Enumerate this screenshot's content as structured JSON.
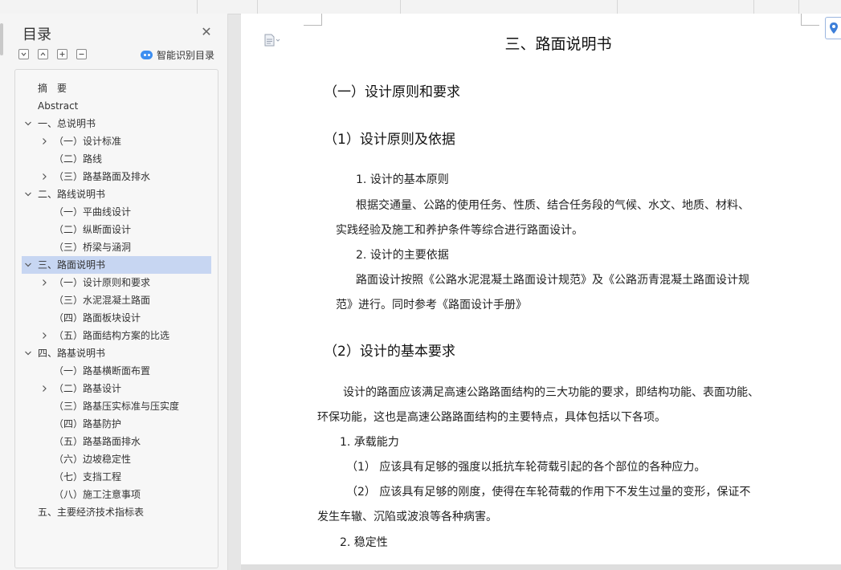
{
  "toc": {
    "title": "目录",
    "ai_button_label": "智能识别目录",
    "items": [
      {
        "label": "摘　要",
        "level": 0,
        "expand": "none"
      },
      {
        "label": "Abstract",
        "level": 0,
        "expand": "none"
      },
      {
        "label": "一、总说明书",
        "level": 0,
        "expand": "expanded"
      },
      {
        "label": "（一）设计标准",
        "level": 1,
        "expand": "collapsed"
      },
      {
        "label": "（二）路线",
        "level": 1,
        "expand": "none"
      },
      {
        "label": "（三）路基路面及排水",
        "level": 1,
        "expand": "collapsed"
      },
      {
        "label": "二、路线说明书",
        "level": 0,
        "expand": "expanded"
      },
      {
        "label": "（一）平曲线设计",
        "level": 1,
        "expand": "none"
      },
      {
        "label": "（二）纵断面设计",
        "level": 1,
        "expand": "none"
      },
      {
        "label": "（三）桥梁与涵洞",
        "level": 1,
        "expand": "none"
      },
      {
        "label": "三、路面说明书",
        "level": 0,
        "expand": "expanded",
        "selected": true
      },
      {
        "label": "（一）设计原则和要求",
        "level": 1,
        "expand": "collapsed"
      },
      {
        "label": "（三）水泥混凝土路面",
        "level": 1,
        "expand": "none"
      },
      {
        "label": "（四）路面板块设计",
        "level": 1,
        "expand": "none"
      },
      {
        "label": "（五）路面结构方案的比选",
        "level": 1,
        "expand": "collapsed"
      },
      {
        "label": "四、路基说明书",
        "level": 0,
        "expand": "expanded"
      },
      {
        "label": "（一）路基横断面布置",
        "level": 1,
        "expand": "none"
      },
      {
        "label": "（二）路基设计",
        "level": 1,
        "expand": "collapsed"
      },
      {
        "label": "（三）路基压实标准与压实度",
        "level": 1,
        "expand": "none"
      },
      {
        "label": "（四）路基防护",
        "level": 1,
        "expand": "none"
      },
      {
        "label": "（五）路基路面排水",
        "level": 1,
        "expand": "none"
      },
      {
        "label": "（六）边坡稳定性",
        "level": 1,
        "expand": "none"
      },
      {
        "label": "（七）支挡工程",
        "level": 1,
        "expand": "none"
      },
      {
        "label": "（八）施工注意事项",
        "level": 1,
        "expand": "none"
      },
      {
        "label": "五、主要经济技术指标表",
        "level": 0,
        "expand": "none"
      }
    ]
  },
  "document": {
    "lines": [
      {
        "text": "三、路面说明书",
        "style": "h0"
      },
      {
        "text": "（一）设计原则和要求",
        "style": "h1"
      },
      {
        "text": "（1）设计原则及依据",
        "style": "h1"
      },
      {
        "text": "1. 设计的基本原则",
        "style": "p"
      },
      {
        "text": "根据交通量、公路的使用任务、性质、结合任务段的气候、水文、地质、材料、",
        "style": "p"
      },
      {
        "text": "实践经验及施工和养护条件等综合进行路面设计。",
        "style": "p"
      },
      {
        "text": "2. 设计的主要依据",
        "style": "p"
      },
      {
        "text": "路面设计按照《公路水泥混凝土路面设计规范》及《公路沥青混凝土路面设计规",
        "style": "p"
      },
      {
        "text": "范》进行。同时参考《路面设计手册》",
        "style": "p"
      },
      {
        "text": "（2）设计的基本要求",
        "style": "h1"
      },
      {
        "text": "设计的路面应该满足高速公路路面结构的三大功能的要求，即结构功能、表面功能、",
        "style": "p"
      },
      {
        "text": "环保功能，这也是高速公路路面结构的主要特点，具体包括以下各项。",
        "style": "p"
      },
      {
        "text": "1. 承载能力",
        "style": "p"
      },
      {
        "text": "（1） 应该具有足够的强度以抵抗车轮荷载引起的各个部位的各种应力。",
        "style": "p"
      },
      {
        "text": "（2） 应该具有足够的刚度，使得在车轮荷载的作用下不发生过量的变形，保证不",
        "style": "p"
      },
      {
        "text": "发生车辙、沉陷或波浪等各种病害。",
        "style": "p"
      },
      {
        "text": "2. 稳定性",
        "style": "p"
      }
    ]
  },
  "colors": {
    "selected_row": "#c7d6f2",
    "accent": "#3d8ef0"
  }
}
